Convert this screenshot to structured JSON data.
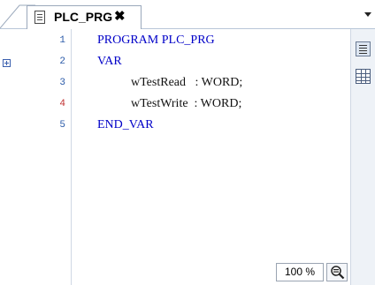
{
  "tab": {
    "title": "PLC_PRG",
    "close_glyph": "✖"
  },
  "editor": {
    "lines": [
      {
        "number": "1",
        "text": "PROGRAM PLC_PRG",
        "modified": false
      },
      {
        "number": "2",
        "text": "VAR",
        "modified": false
      },
      {
        "number": "3",
        "text": "wTestRead   : WORD;",
        "modified": false
      },
      {
        "number": "4",
        "text": "wTestWrite  : WORD;",
        "modified": true
      },
      {
        "number": "5",
        "text": "END_VAR",
        "modified": false
      }
    ]
  },
  "toolbar": {
    "textview_icon": "text-view-icon",
    "tableview_icon": "table-view-icon"
  },
  "zoom": {
    "level": "100 %",
    "icon": "magnifier-icon"
  },
  "colors": {
    "keyword": "#0000c8",
    "line_number": "#2a5aa8",
    "modified_line_number": "#c03030"
  }
}
